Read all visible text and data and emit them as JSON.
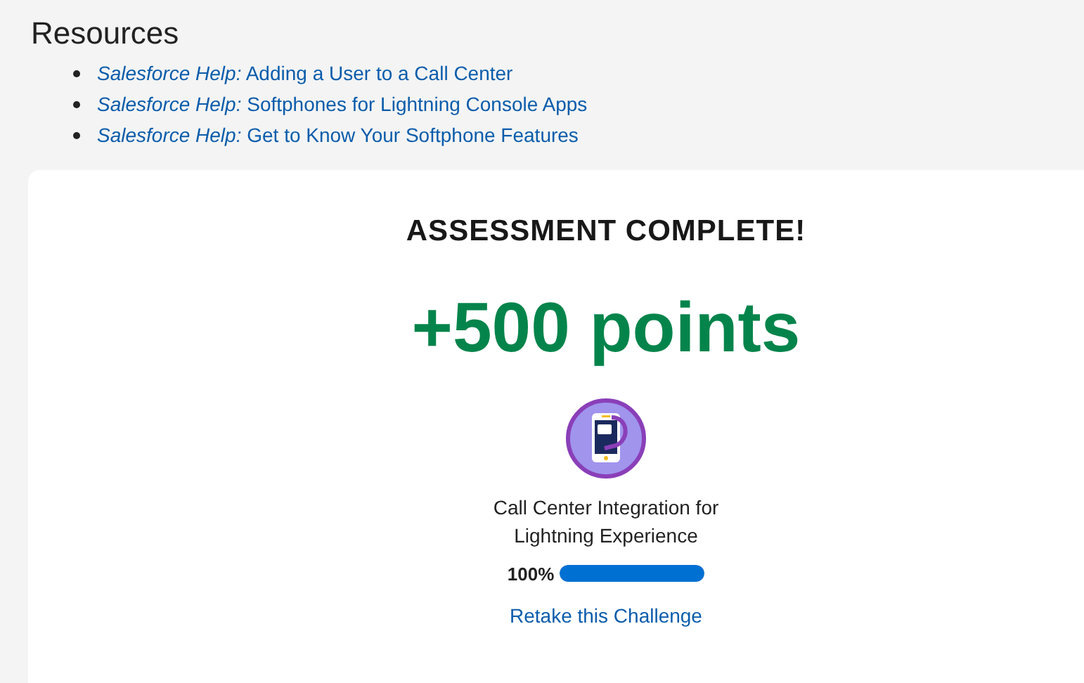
{
  "resources": {
    "title": "Resources",
    "links": [
      {
        "text": "*Salesforce Help:* Adding a User to a Call Center"
      },
      {
        "text": "*Salesforce Help:* Softphones for Lightning Console Apps"
      },
      {
        "text": "*Salesforce Help:* Get to Know Your Softphone Features"
      }
    ]
  },
  "result": {
    "heading": "ASSESSMENT COMPLETE!",
    "points": "+500 points",
    "badge_title": "Call Center Integration for Lightning Experience",
    "progress_text": "100%",
    "level": 1,
    "retake_link": "Retake this Challenge"
  }
}
